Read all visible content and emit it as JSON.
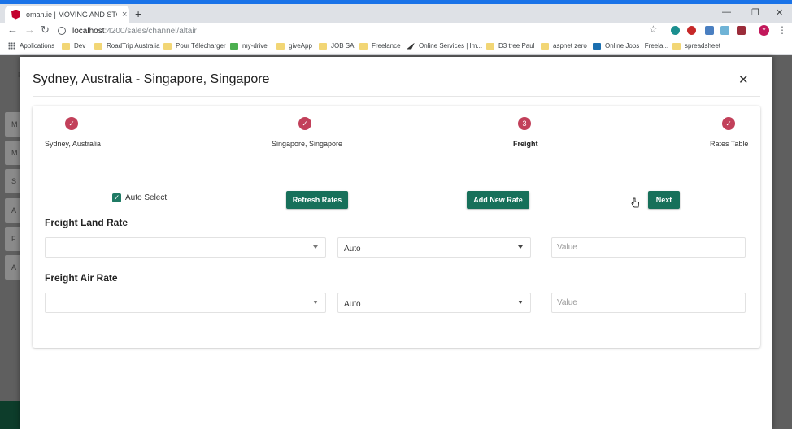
{
  "browser": {
    "tab_title": "oman.ie | MOVING AND STORAGE",
    "tab_close": "×",
    "new_tab": "+",
    "url_host": "localhost",
    "url_path": ":4200/sales/channel/altair",
    "profile_initial": "Y",
    "window_controls": [
      "—",
      "❐",
      "✕"
    ],
    "bookmarks": [
      {
        "label": "Applications",
        "icon": "apps-grid-icon"
      },
      {
        "label": "Dev",
        "icon": "folder-icon"
      },
      {
        "label": "RoadTrip Australia",
        "icon": "folder-icon"
      },
      {
        "label": "Pour Télécharger",
        "icon": "folder-icon"
      },
      {
        "label": "my-drive",
        "icon": "drive-icon"
      },
      {
        "label": "giveApp",
        "icon": "folder-icon"
      },
      {
        "label": "JOB SA",
        "icon": "folder-icon"
      },
      {
        "label": "Freelance",
        "icon": "folder-icon"
      },
      {
        "label": "Online Services | Im...",
        "icon": "bird-icon"
      },
      {
        "label": "D3 tree Paul",
        "icon": "folder-icon"
      },
      {
        "label": "aspnet zero",
        "icon": "folder-icon"
      },
      {
        "label": "Online Jobs | Freela...",
        "icon": "y-icon"
      },
      {
        "label": "spreadsheet",
        "icon": "folder-icon"
      }
    ]
  },
  "side_menu": [
    "M",
    "M",
    "S",
    "A",
    "F",
    "A"
  ],
  "modal": {
    "title": "Sydney, Australia - Singapore, Singapore",
    "close": "✕"
  },
  "stepper": {
    "steps": [
      {
        "label": "Sydney, Australia",
        "state": "done",
        "marker": "✓"
      },
      {
        "label": "Singapore, Singapore",
        "state": "done",
        "marker": "✓"
      },
      {
        "label": "Freight",
        "state": "active",
        "marker": "3"
      },
      {
        "label": "Rates Table",
        "state": "done",
        "marker": "✓"
      }
    ]
  },
  "actions": {
    "auto_select_label": "Auto Select",
    "auto_select_checked": true,
    "check_mark": "✓",
    "refresh_label": "Refresh Rates",
    "add_label": "Add New Rate",
    "next_label": "Next"
  },
  "freight_land": {
    "title": "Freight Land Rate",
    "rate_select_value": "",
    "mode_select_value": "Auto",
    "value_placeholder": "Value"
  },
  "freight_air": {
    "title": "Freight Air Rate",
    "rate_select_value": "",
    "mode_select_value": "Auto",
    "value_placeholder": "Value"
  },
  "colors": {
    "accent_green": "#17705a",
    "step_red": "#c2405a",
    "browser_blue": "#1a73e8"
  }
}
